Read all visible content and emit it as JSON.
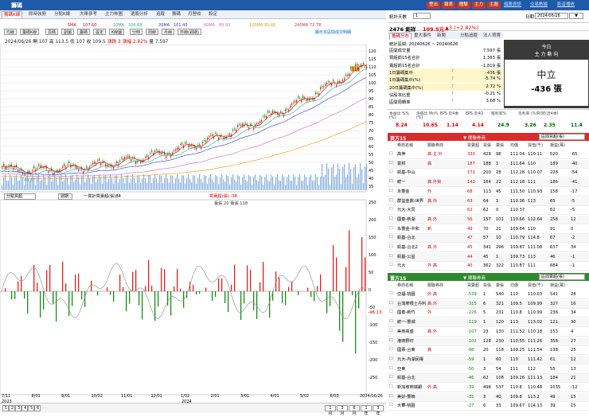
{
  "titlebar": {
    "title": "籌碼",
    "buttons": [
      "登出",
      "報表",
      "體驗",
      "主力",
      "主題"
    ],
    "links": [
      "個股資訊",
      "交易數據",
      "影音播放"
    ]
  },
  "tabs": [
    "籌碼K線",
    "即時強勢",
    "分點K線",
    "大單參考",
    "主力佈圖",
    "選股分析",
    "追蹤",
    "籌碼",
    "月營收",
    "設定"
  ],
  "ma_labels": [
    {
      "t": "5MA",
      "v": "107.60",
      "c": "#d00"
    },
    {
      "t": "10MA",
      "v": "106.68",
      "c": "#2a8"
    },
    {
      "t": "20MA",
      "v": "101.40",
      "c": "#33c"
    },
    {
      "t": "60MA",
      "v": "89.93",
      "c": "#c6c"
    },
    {
      "t": "120MA",
      "v": "82.66",
      "c": "#e90"
    },
    {
      "t": "240MA",
      "v": "72.78",
      "c": "#c33"
    }
  ],
  "toolbar": [
    "均線",
    "籌碼K線",
    "頁碼",
    "副圖",
    "籌碼",
    "設定",
    "K線圖",
    "分時",
    "周線",
    "月線",
    "日線(週期)"
  ],
  "toolbar_right": "顯示本區間成交明細",
  "ohlc": {
    "date": "2024/06/26",
    "open": "開 107",
    "high": "高 113.5",
    "low": "低 107",
    "close": "收 109.5",
    "change": "漲跌 3",
    "pct": "漲幅 2.82%",
    "vol": "量 7,597"
  },
  "price_axis": [
    "120",
    "115",
    "110",
    "105",
    "100",
    "95",
    "90",
    "85",
    "80",
    "75",
    "70",
    "65",
    "60",
    "55",
    "50",
    "45",
    "40",
    "35"
  ],
  "osc_axis": [
    "250",
    "200",
    "150",
    "100",
    "50",
    "0",
    "-50",
    "-100",
    "-150",
    "-200",
    "-250"
  ],
  "x_labels": [
    "7/11",
    "8/01",
    "9/01",
    "10/02",
    "11/01",
    "12/01",
    "1/02",
    "2/01",
    "3/01",
    "4/01",
    "5/02",
    "6/03",
    "2024/06/26"
  ],
  "x_years": {
    "a": "2023",
    "b": "2024"
  },
  "price_tag_hi": "118",
  "price_tag_lo": "44.5",
  "osc_value": "-46.13",
  "indicator": {
    "sel": "分點買超",
    "period": "週期",
    "legend1": "一買計買賣超(張)84",
    "legend2": "買賣超(張) -38",
    "legend3": "賣張 20 賣張 118"
  },
  "bottom": {
    "pages": [
      "1",
      "2",
      "3",
      "4",
      "5",
      "6"
    ],
    "range": [
      "1月",
      "3月",
      "6月",
      "1年",
      "3年"
    ]
  },
  "right": {
    "stat_days": "統計天數",
    "stat_days_val": "1",
    "date_label": "日期",
    "date_val": "2024/06/26",
    "stock": "2476 鉅祥",
    "price": "109.5元",
    "chg": "▲3 (+2.82%)",
    "subtabs": [
      "籌碼分布",
      "重大事件",
      "新聞",
      "分點追蹤",
      "法人買賣"
    ],
    "range": "統計區間: 20240626 ~ 20240626",
    "metrics": [
      [
        "區間成交量",
        "",
        "7,597 張"
      ],
      [
        "買超前15名合計",
        "",
        "1,383 張"
      ],
      [
        "賣超前15名合計",
        "",
        "-1,819 張"
      ],
      [
        "1日籌碼集中",
        "?",
        "-436 張"
      ],
      [
        "1日籌碼集中(%)",
        "?",
        "-5.74 %"
      ],
      [
        "20日籌碼集中(%)",
        "?",
        "2.72 %"
      ],
      [
        "佔股本比重",
        "?",
        "-0.21 %"
      ],
      [
        "區間周轉率",
        "?",
        "3.68 %"
      ]
    ],
    "today_label": "今日",
    "main_flow": "主 力 動 向",
    "neutral": "中立",
    "neutral_val": "-436 張",
    "fin_headers": [
      "本益比 %%(%)",
      "淨值比 Mo%(%)",
      "EPS 近4季",
      "EPS 近4Q",
      "殖利率%",
      "毛利率 (%)",
      "ROE(近4季)"
    ],
    "fin_values": [
      "8.24",
      "10.65",
      "1.14",
      "4.14",
      "24.9",
      "3.26",
      "2.35",
      "11.4"
    ],
    "buy_title": "買方15",
    "buy_broker_title": "▼ 關聯券商",
    "buy_sel": "區間買超(張)",
    "cols": [
      "券商名稱",
      "關聯券商",
      "買賣超",
      "買張",
      "賣張",
      "均價",
      "買值(千)",
      "損益(萬)"
    ],
    "buy_rows": [
      [
        "高伸",
        "高.主.外",
        "330",
        "428",
        "98",
        "111.04",
        "110.11",
        "520",
        "-65"
      ],
      [
        "富邦",
        "高",
        "187",
        "188",
        "1",
        "111.64",
        "110",
        "189",
        "-40"
      ],
      [
        "凱基-中山",
        "",
        "172",
        "200",
        "28",
        "112.28",
        "110.07",
        "228",
        "-54"
      ],
      [
        "統一",
        "高.外資",
        "142",
        "164",
        "22",
        "112.18",
        "111",
        "186",
        "-41"
      ],
      [
        "永豐金",
        "外",
        "68",
        "113",
        "45",
        "111.50",
        "110.93",
        "158",
        "-17"
      ],
      [
        "群益金鼎-世界",
        "高.外",
        "63",
        "64",
        "1",
        "110.36",
        "113",
        "65",
        "-5"
      ],
      [
        "元大-大同",
        "",
        "62",
        "62",
        "0",
        "110.37",
        "",
        "62",
        "-5"
      ],
      [
        "國泰-新湖",
        "高.外",
        "56",
        "157",
        "101",
        "110.66",
        "112.64",
        "258",
        "12"
      ],
      [
        "永豐金-中和",
        "新",
        "49",
        "70",
        "21",
        "109.64",
        "110",
        "91",
        "0"
      ],
      [
        "凱基-台北",
        "",
        "47",
        "57",
        "10",
        "110.79",
        "114.8",
        "67",
        "-2"
      ],
      [
        "凱基-台北2",
        "高.外",
        "45",
        "341",
        "296",
        "109.87",
        "111.08",
        "637",
        "34"
      ],
      [
        "凱基-公益",
        "",
        "44",
        "45",
        "1",
        "109.73",
        "113",
        "46",
        "-1"
      ],
      [
        "元大",
        "外.高",
        "40",
        "362",
        "322",
        "110.87",
        "111",
        "684",
        "-1"
      ]
    ],
    "sell_title": "賣方15",
    "sell_broker_title": "▼ 關聯券商",
    "sell_sel": "區間賣超(張)",
    "sell_rows": [
      [
        "亞福-桃園",
        "外.高",
        "-539",
        "1",
        "540",
        "110",
        "110.03",
        "541",
        "28"
      ],
      [
        "台灣摩根士丹利",
        "高.外",
        "-315",
        "6",
        "321",
        "109.5",
        "109.99",
        "327",
        "16"
      ],
      [
        "國泰-新竹",
        "外",
        "-226",
        "5",
        "231",
        "110.8",
        "110.99",
        "236",
        "34"
      ],
      [
        "統一-豐城",
        "",
        "-119",
        "1",
        "120",
        "113",
        "113.02",
        "121",
        "30"
      ],
      [
        "美商高盛",
        "高.外",
        "-107",
        "23",
        "130",
        "111.52",
        "110.18",
        "153",
        "4"
      ],
      [
        "港商野村",
        "",
        "-102",
        "128",
        "230",
        "110.55",
        "111.26",
        "358",
        "27"
      ],
      [
        "國票-台東",
        "高",
        "-98",
        "20",
        "118",
        "109.25",
        "111.54",
        "138",
        "25"
      ],
      [
        "元大-內湖民權",
        "",
        "-59",
        "1",
        "60",
        "110",
        "111.42",
        "61",
        "12"
      ],
      [
        "亞東",
        "",
        "-50",
        "3",
        "54",
        "111",
        "112",
        "55",
        "13"
      ],
      [
        "凱基-台北",
        "",
        "-46",
        "62",
        "108",
        "109.26",
        "111.13",
        "184",
        "21"
      ],
      [
        "新加坡商瑞銀",
        "外.高",
        "-39",
        "498",
        "537",
        "110.8",
        "110.48",
        "1035",
        "-12"
      ],
      [
        "美好-豐楠",
        "",
        "-35",
        "3",
        "40",
        "109.8",
        "113.2",
        "49",
        "15"
      ],
      [
        "大華-桃園",
        "",
        "-27",
        "6",
        "33",
        "109.67",
        "114.13",
        "39",
        "15"
      ]
    ]
  }
}
